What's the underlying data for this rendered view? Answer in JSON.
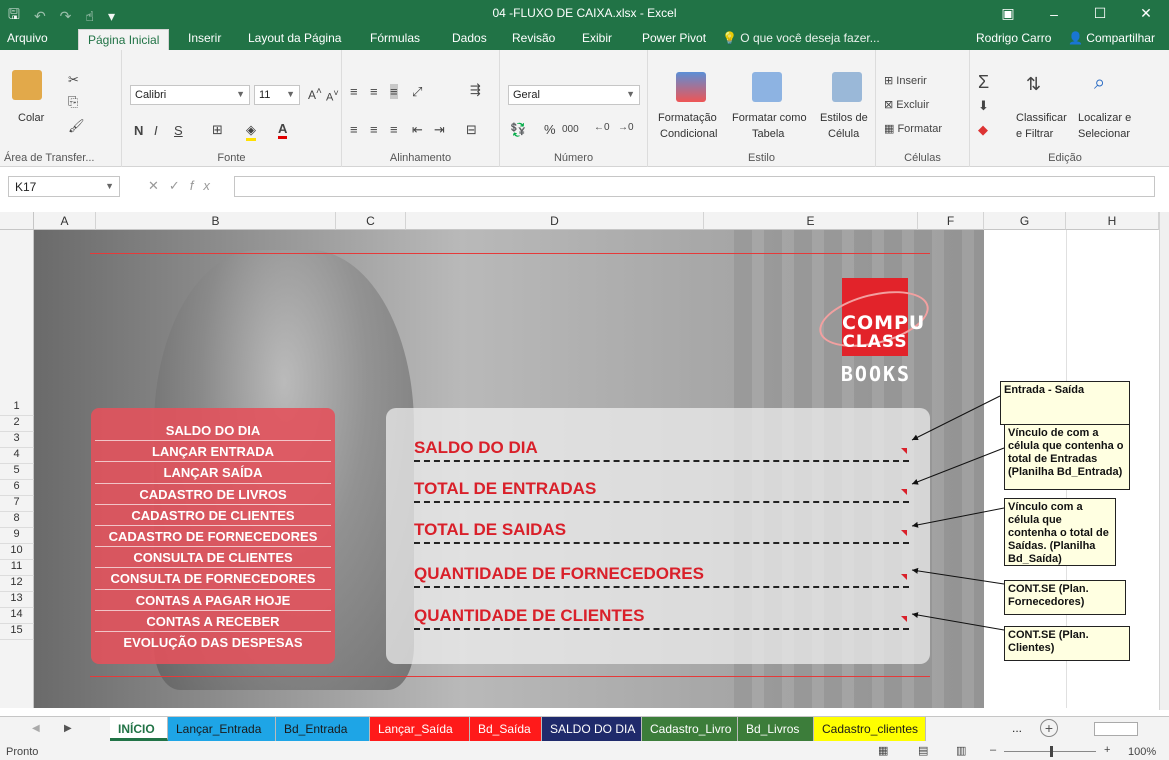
{
  "window": {
    "title": "04 -FLUXO DE CAIXA.xlsx - Excel",
    "colors": {
      "brand": "#217346"
    }
  },
  "ribbon_tabs": [
    "Arquivo",
    "Página Inicial",
    "Inserir",
    "Layout da Página",
    "Fórmulas",
    "Dados",
    "Revisão",
    "Exibir",
    "Power Pivot"
  ],
  "tell_me": "O que você deseja fazer...",
  "user": "Rodrigo Carro",
  "share": "Compartilhar",
  "ribbon": {
    "clipboard": {
      "paste": "Colar",
      "label": "Área de Transfer..."
    },
    "font": {
      "name": "Calibri",
      "size": "11",
      "bold": "N",
      "italic": "I",
      "underline": "S",
      "label": "Fonte"
    },
    "alignment": {
      "label": "Alinhamento"
    },
    "number": {
      "format": "Geral",
      "percent": "%",
      "thousands": "000",
      "label": "Número"
    },
    "styles": {
      "cond_format": "Formatação",
      "cond_format2": "Condicional",
      "format_table": "Formatar como",
      "format_table2": "Tabela",
      "cell_styles": "Estilos de",
      "cell_styles2": "Célula",
      "label": "Estilo"
    },
    "cells": {
      "insert": "Inserir",
      "delete": "Excluir",
      "format": "Formatar",
      "label": "Células"
    },
    "editing": {
      "sort": "Classificar",
      "sort2": "e Filtrar",
      "find": "Localizar e",
      "find2": "Selecionar",
      "label": "Edição"
    }
  },
  "formula_bar": {
    "name_box": "K17",
    "fx": "fx"
  },
  "columns": [
    "A",
    "B",
    "C",
    "D",
    "E",
    "F",
    "G",
    "H"
  ],
  "rows": [
    "1",
    "2",
    "3",
    "4",
    "5",
    "6",
    "7",
    "8",
    "9",
    "10",
    "11",
    "12",
    "13",
    "14",
    "15"
  ],
  "logo": {
    "line1": "COMPU",
    "line2": "CLASS",
    "line3": "BOOKS"
  },
  "menu": [
    "SALDO DO DIA",
    "LANÇAR ENTRADA",
    "LANÇAR SAÍDA",
    "CADASTRO DE LIVROS",
    "CADASTRO DE CLIENTES",
    "CADASTRO DE FORNECEDORES",
    "CONSULTA DE CLIENTES",
    "CONSULTA DE FORNECEDORES",
    "CONTAS A PAGAR HOJE",
    "CONTAS A RECEBER",
    "EVOLUÇÃO DAS DESPESAS"
  ],
  "summary": [
    "SALDO DO DIA",
    "TOTAL DE ENTRADAS",
    "TOTAL DE SAIDAS",
    "QUANTIDADE DE FORNECEDORES",
    "QUANTIDADE DE CLIENTES"
  ],
  "notes": [
    "Entrada - Saída",
    "Vínculo de com a célula que contenha o total de Entradas (Planilha Bd_Entrada)",
    "Vínculo com a célula que contenha o total de Saídas. (Planilha Bd_Saída)",
    "CONT.SE (Plan. Fornecedores)",
    "CONT.SE (Plan. Clientes)"
  ],
  "sheet_tabs": [
    {
      "label": "INÍCIO",
      "bg": "#ffffff",
      "fg": "#217346"
    },
    {
      "label": "Lançar_Entrada",
      "bg": "#1ea5e6",
      "fg": "#1a1a1a"
    },
    {
      "label": "Bd_Entrada",
      "bg": "#1ea5e6",
      "fg": "#1a1a1a"
    },
    {
      "label": "Lançar_Saída",
      "bg": "#ff1a1a",
      "fg": "#ffffff"
    },
    {
      "label": "Bd_Saída",
      "bg": "#ff1a1a",
      "fg": "#ffffff"
    },
    {
      "label": "SALDO DO DIA",
      "bg": "#1f2a6b",
      "fg": "#ffffff"
    },
    {
      "label": "Cadastro_Livro",
      "bg": "#3c7d3a",
      "fg": "#ffffff"
    },
    {
      "label": "Bd_Livros",
      "bg": "#3c7d3a",
      "fg": "#ffffff"
    },
    {
      "label": "Cadastro_clientes",
      "bg": "#ffff00",
      "fg": "#1a1a1a"
    }
  ],
  "more_tabs": "...",
  "status": {
    "ready": "Pronto",
    "zoom": "100%"
  }
}
